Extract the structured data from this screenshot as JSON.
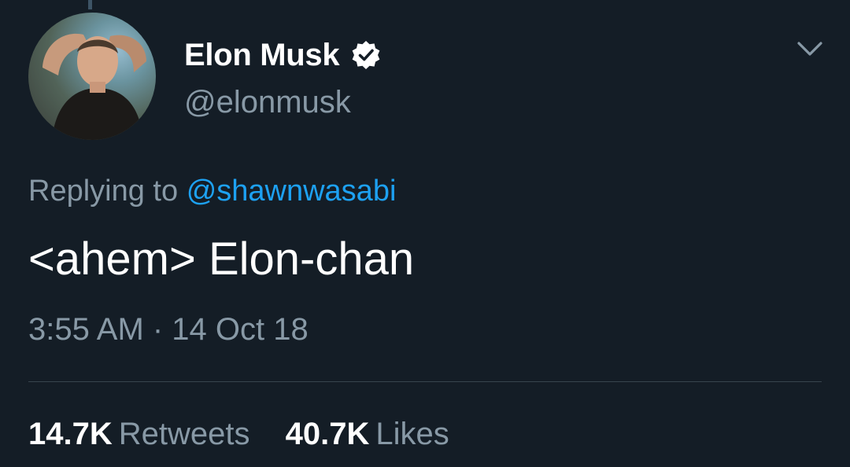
{
  "tweet": {
    "author": {
      "display_name": "Elon Musk",
      "handle": "@elonmusk",
      "verified": true,
      "avatar_icon": "profile-photo"
    },
    "reply": {
      "prefix": "Replying to",
      "mention": "@shawnwasabi"
    },
    "text": "<ahem> Elon-chan",
    "timestamp": "3:55 AM · 14 Oct 18",
    "stats": {
      "retweets_count": "14.7K",
      "retweets_label": "Retweets",
      "likes_count": "40.7K",
      "likes_label": "Likes"
    },
    "menu_icon": "chevron-down-icon"
  },
  "colors": {
    "background": "#141d26",
    "primary_text": "#ffffff",
    "secondary_text": "#8899a6",
    "link": "#1da1f2",
    "divider": "#38444d",
    "verified_badge": "#ffffff"
  }
}
